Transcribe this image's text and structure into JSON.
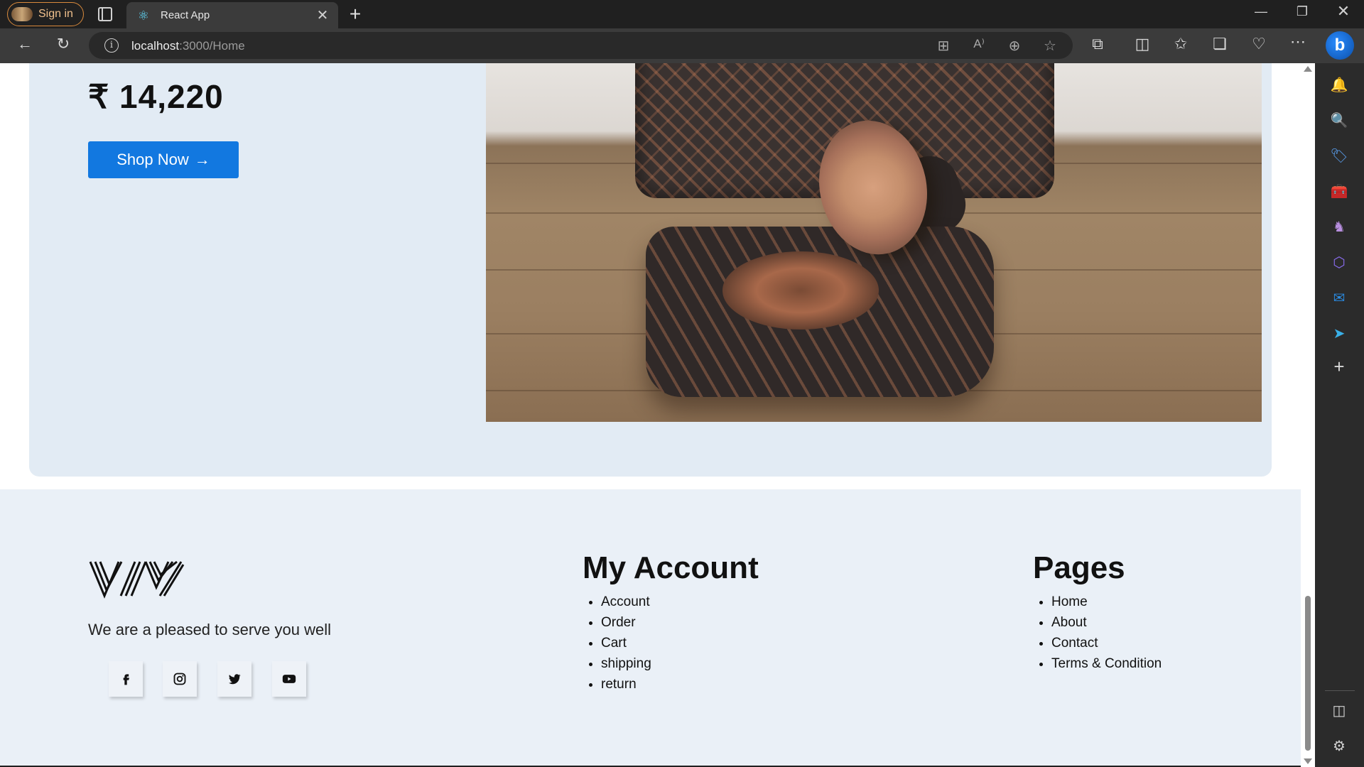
{
  "browser": {
    "sign_in_label": "Sign in",
    "tab_title": "React App",
    "url_host": "localhost",
    "url_path": ":3000/Home"
  },
  "hero": {
    "price": "₹ 14,220",
    "cta_label": "Shop Now",
    "cta_arrow": "→",
    "image_description": "terracotta seal and engraved tablet on wooden surface"
  },
  "footer": {
    "tagline": "We are a pleased to serve you well",
    "social": [
      "facebook-icon",
      "instagram-icon",
      "twitter-icon",
      "youtube-icon"
    ],
    "my_account": {
      "heading": "My Account",
      "links": [
        "Account",
        "Order",
        "Cart",
        "shipping",
        "return"
      ]
    },
    "pages": {
      "heading": "Pages",
      "links": [
        "Home",
        "About",
        "Contact",
        "Terms & Condition"
      ]
    }
  },
  "colors": {
    "accent": "#1278e0",
    "hero_bg": "#e2ebf4",
    "footer_bg": "#eaf0f7",
    "chrome_bg": "#202020"
  }
}
